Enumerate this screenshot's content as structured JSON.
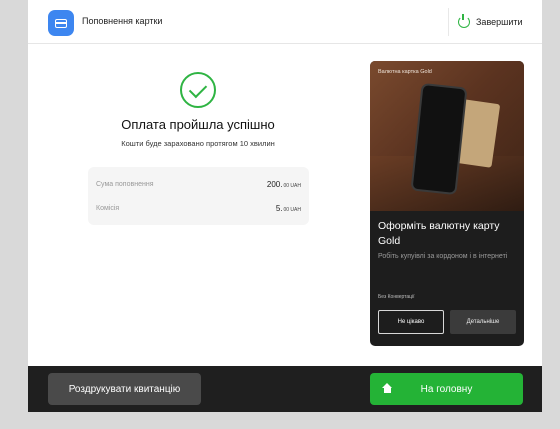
{
  "header": {
    "title": "Поповнення картки",
    "finish_label": "Завершити"
  },
  "result": {
    "title": "Оплата пройшла успішно",
    "subtitle": "Кошти буде зараховано протягом 10 хвилин"
  },
  "details": [
    {
      "label": "Сума поповнення",
      "amount": "200.",
      "fraction": "00 UAH"
    },
    {
      "label": "Комісія",
      "amount": "5.",
      "fraction": "00 UAH"
    }
  ],
  "promo": {
    "tag": "Валютна картка Gold",
    "title": "Оформіть валютну карту Gold",
    "description": "Робіть купуівлі за кордоном і в інтернеті",
    "note": "Без Конвертації",
    "decline_label": "Не цікаво",
    "more_label": "Детальніше"
  },
  "footer": {
    "print_label": "Роздрукувати квитанцію",
    "home_label": "На головну"
  },
  "colors": {
    "accent_green": "#24b336",
    "app_icon_blue": "#3d86f0"
  },
  "icons": [
    "card-icon",
    "power-icon",
    "checkmark-icon",
    "home-icon"
  ]
}
